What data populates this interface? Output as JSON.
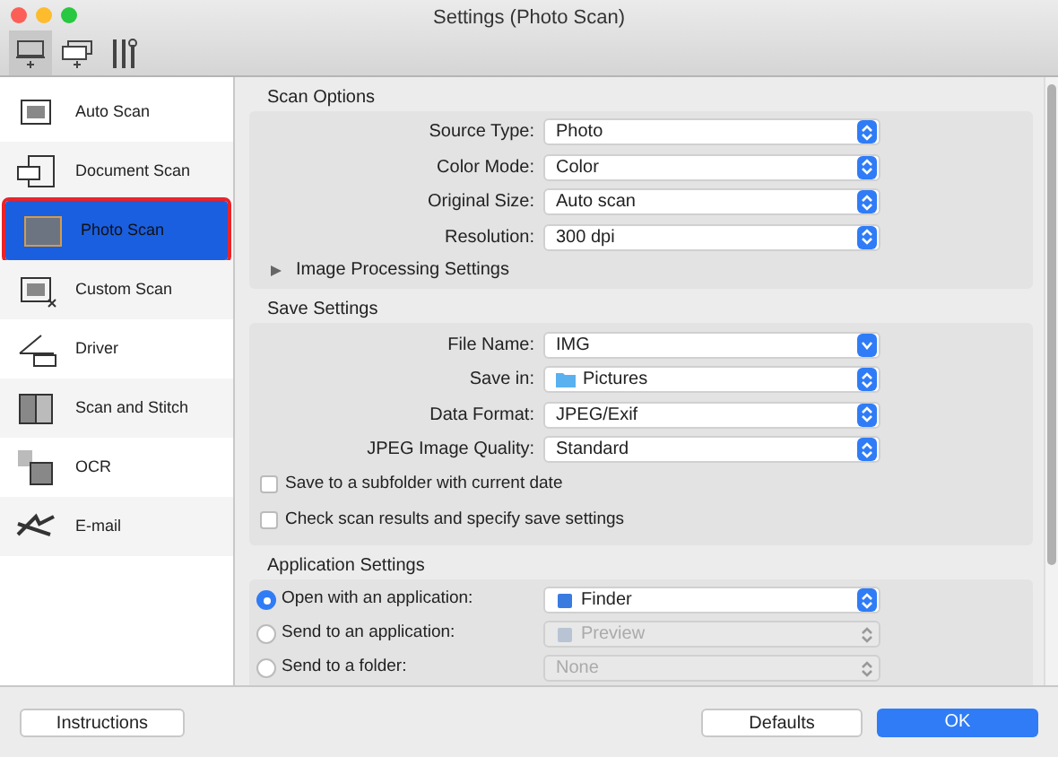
{
  "window": {
    "title": "Settings (Photo Scan)"
  },
  "toolbar": [
    {
      "selected": true
    },
    {
      "selected": false
    },
    {
      "selected": false
    }
  ],
  "sidebar": {
    "items": [
      {
        "label": "Auto Scan",
        "selected": false
      },
      {
        "label": "Document Scan",
        "selected": false
      },
      {
        "label": "Photo Scan",
        "selected": true
      },
      {
        "label": "Custom Scan",
        "selected": false
      },
      {
        "label": "Driver",
        "selected": false
      },
      {
        "label": "Scan and Stitch",
        "selected": false
      },
      {
        "label": "OCR",
        "selected": false
      },
      {
        "label": "E-mail",
        "selected": false
      }
    ]
  },
  "scan_options": {
    "title": "Scan Options",
    "fields": [
      {
        "label": "Source Type:",
        "value": "Photo",
        "kind": "popup"
      },
      {
        "label": "Color Mode:",
        "value": "Color",
        "kind": "popup"
      },
      {
        "label": "Original Size:",
        "value": "Auto scan",
        "kind": "popup"
      },
      {
        "label": "Resolution:",
        "value": "300 dpi",
        "kind": "popup"
      }
    ],
    "disclosure": {
      "label": "Image Processing Settings",
      "expanded": false
    }
  },
  "save_settings": {
    "title": "Save Settings",
    "fields": [
      {
        "label": "File Name:",
        "value": "IMG",
        "kind": "combo"
      },
      {
        "label": "Save in:",
        "value": "Pictures",
        "kind": "folder"
      },
      {
        "label": "Data Format:",
        "value": "JPEG/Exif",
        "kind": "popup"
      },
      {
        "label": "JPEG Image Quality:",
        "value": "Standard",
        "kind": "popup"
      }
    ],
    "checkboxes": [
      {
        "label": "Save to a subfolder with current date",
        "checked": false
      },
      {
        "label": "Check scan results and specify save settings",
        "checked": false
      }
    ]
  },
  "application_settings": {
    "title": "Application Settings",
    "options": [
      {
        "label": "Open with an application:",
        "value": "Finder",
        "selected": true
      },
      {
        "label": "Send to an application:",
        "value": "Preview",
        "selected": false
      },
      {
        "label": "Send to a folder:",
        "value": "None",
        "selected": false
      }
    ]
  },
  "buttons": {
    "instructions": "Instructions",
    "defaults": "Defaults",
    "ok": "OK"
  }
}
